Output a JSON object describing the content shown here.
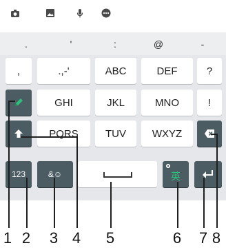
{
  "toolbar": {
    "icons": [
      "camera-icon",
      "image-icon",
      "microphone-icon",
      "more-icon"
    ],
    "icon_color": "#4a4a4a"
  },
  "keyboard": {
    "background": "#e6e7ea",
    "accent": "#4c5c63",
    "symbol_row": [
      ".",
      "'",
      ":",
      "@",
      "-"
    ],
    "row1": {
      "key1": ",",
      "key2": ".,-'",
      "key3": "ABC",
      "key4": "DEF",
      "key5": "?"
    },
    "row2": {
      "key2": "GHI",
      "key3": "JKL",
      "key4": "MNO",
      "key5": "!"
    },
    "row3": {
      "key2": "PQRS",
      "key3": "TUV",
      "key4": "WXYZ"
    },
    "row4": {
      "numbers": "123",
      "emoji": "&☺",
      "language": "英"
    }
  },
  "callouts": [
    "1",
    "2",
    "3",
    "4",
    "5",
    "6",
    "7",
    "8"
  ]
}
